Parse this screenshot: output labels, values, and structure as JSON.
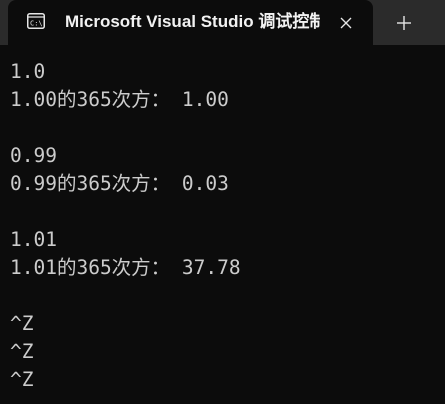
{
  "window": {
    "tab_title": "Microsoft Visual Studio 调试控制台",
    "tab_icon": "console-icon",
    "close_icon": "close-icon",
    "new_tab_icon": "plus-icon"
  },
  "console": {
    "lines": [
      "1.0",
      "1.00的365次方： 1.00",
      "",
      "0.99",
      "0.99的365次方： 0.03",
      "",
      "1.01",
      "1.01的365次方： 37.78",
      "",
      "^Z",
      "^Z",
      "^Z"
    ]
  },
  "colors": {
    "background": "#0c0c0c",
    "titlebar": "#2b2b2b",
    "text": "#cccccc"
  }
}
